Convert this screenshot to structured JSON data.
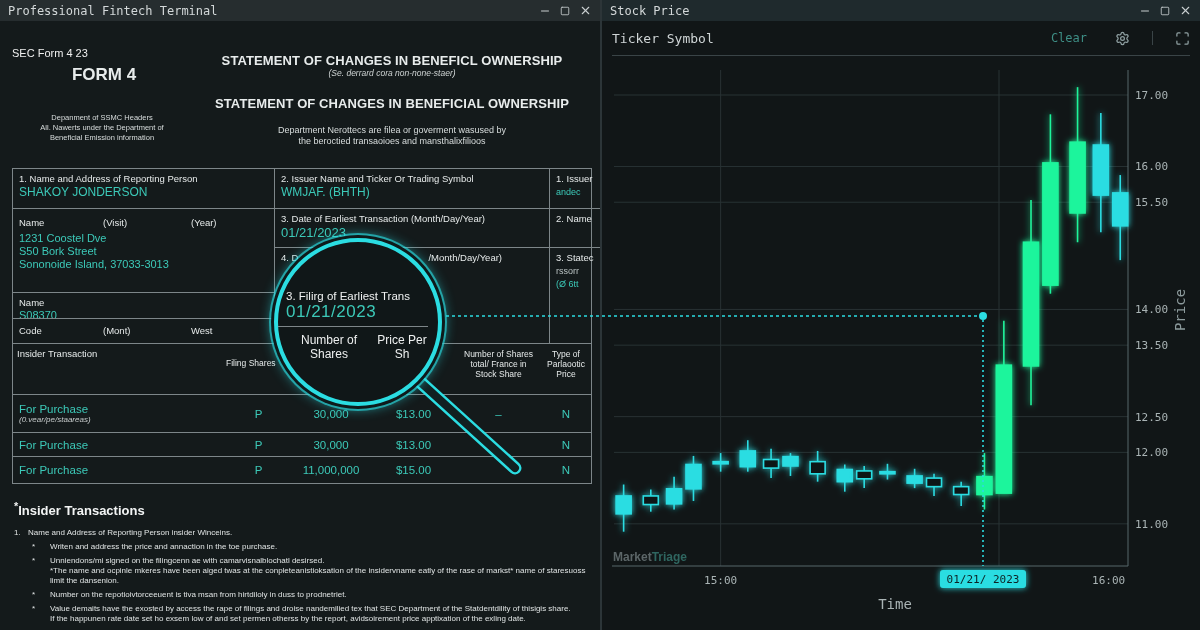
{
  "form_window": {
    "title": "Professional Fintech Terminal",
    "form_label": "SEC Form 4 23",
    "form_number": "FORM 4",
    "department_lines": [
      "Depanment of SSMC Headers",
      "All. Nawerts under the Department of",
      "Beneficial Emission information"
    ],
    "title_primary": "STATEMENT OF CHANGES IN BENEFICL OWNERSHIP",
    "subtitle": "(Se. derrard cora non-none-staer)",
    "title_secondary": "STATEMENT OF CHANGES IN BENEFICIAL OWNERSHIP",
    "notice_lines": [
      "Department Nerottecs are filea or goverment wasused by",
      "the beroctied transaoioes and mansthalixfilioos"
    ],
    "reporting_person": {
      "label": "1. Name and Address of Reporting Person",
      "value": "SHAKOY JONDERSON"
    },
    "address": {
      "labels": [
        "Name",
        "(Visit)",
        "(Year)"
      ],
      "lines": [
        "1231 Coostel Dve",
        "S50 Bork Street",
        "Sononoide Island, 37033-3013"
      ]
    },
    "identifier": {
      "label": "Name",
      "value": "S08370"
    },
    "code_row": [
      "Code",
      "(Mont)",
      "West"
    ],
    "issuer": {
      "label": "2. Issuer Name and Ticker Or Trading Symbol",
      "value": "WMJAF. (BHTH)"
    },
    "earliest_date": {
      "label": "3. Date of Earliest Transaction (Month/Day/Year)",
      "value": "01/21/2023"
    },
    "amendment_date": {
      "label_start": "4. D",
      "label_end": "/Month/Day/Year)"
    },
    "side_cells": [
      {
        "label": "1. Issuer",
        "values": [
          "andec"
        ]
      },
      {
        "label": "2. Name"
      },
      {
        "label": "3. Statec",
        "values": [
          "rssorr",
          "(Ø 6tt"
        ]
      }
    ],
    "table": {
      "columns": [
        "Insider Transaction",
        "Filing Shares",
        "Number of Shares total/ France in Stock Share",
        "Type of Parlaootic Price"
      ],
      "rows": [
        {
          "transaction": "For Purchase",
          "note": "(0.vear/pe/staareas)",
          "filing": "P",
          "shares": "30,000",
          "price": "$13.00",
          "total": "–",
          "price_type": "N"
        },
        {
          "transaction": "For Purchase",
          "filing": "P",
          "shares": "30,000",
          "price": "$13.00",
          "price_type": "N"
        },
        {
          "transaction": "For Purchase",
          "filing": "P",
          "shares": "11,000,000",
          "price": "$15.00",
          "price_type": "N"
        }
      ]
    },
    "magnifier": {
      "label": "3. Filirg of Earliest Trans",
      "value": "01/21/2023",
      "headers": [
        "Number of Shares",
        "Price Per Sh"
      ]
    },
    "notes": {
      "heading": "$^{*}$Insider Transactions",
      "number": "1.",
      "lead": "Name and Address of Reporting Person insider Winceins.",
      "items": [
        {
          "marker": "*",
          "paragraphs": [
            "Writen and address the price and annaction in the toe purchase."
          ]
        },
        {
          "marker": "*",
          "paragraphs": [
            "Unniendons/mi signed on the filingcenn ae with camarvisnalblochatl desirsed.",
            "*The name and ocpinle mkeres have been aiged twas at the conpleteanistioksation of the insidervname eatly of the rase of markst* name of staresuoss limit the dansenion."
          ]
        },
        {
          "marker": "*",
          "paragraphs": [
            "Number on the repotioivtorceeuent is tiva msan from hirtdiloly in duss to prodnetriet."
          ]
        },
        {
          "marker": "*",
          "paragraphs": [
            "Value demaits have the exosted by access the rape of filings and droise nandemilied tex that SEC Department of the Statdentdility of thisigis share.",
            "If the happunen rate date set ho exsem low of and set permen otherss by the report, avidsoirement price apptixation of the exling date."
          ]
        }
      ]
    }
  },
  "chart_window": {
    "title": "Stock Price",
    "toolbar": {
      "label": "Ticker Symbol",
      "clear": "Clear"
    },
    "chart": {
      "marker_date": "01/21/ 2023",
      "brand": [
        "Market",
        "Triage"
      ],
      "chart_data": {
        "type": "candlestick",
        "x": [
          14.75,
          14.82,
          14.88,
          14.93,
          15.0,
          15.07,
          15.13,
          15.18,
          15.25,
          15.32,
          15.37,
          15.43,
          15.5,
          15.55,
          15.62,
          15.68,
          15.73,
          15.8,
          15.85,
          15.92,
          15.98,
          16.03
        ],
        "ohlc": [
          [
            11.14,
            11.55,
            10.89,
            11.39
          ],
          [
            11.39,
            11.48,
            11.17,
            11.27
          ],
          [
            11.28,
            11.66,
            11.2,
            11.49
          ],
          [
            11.49,
            11.95,
            11.32,
            11.83
          ],
          [
            11.84,
            11.99,
            11.73,
            11.87
          ],
          [
            11.8,
            12.17,
            11.73,
            12.02
          ],
          [
            11.9,
            12.05,
            11.64,
            11.78
          ],
          [
            11.81,
            11.99,
            11.67,
            11.94
          ],
          [
            11.87,
            12.02,
            11.59,
            11.7
          ],
          [
            11.59,
            11.83,
            11.45,
            11.76
          ],
          [
            11.74,
            11.81,
            11.5,
            11.63
          ],
          [
            11.7,
            11.84,
            11.62,
            11.73
          ],
          [
            11.57,
            11.77,
            11.5,
            11.67
          ],
          [
            11.64,
            11.7,
            11.39,
            11.52
          ],
          [
            11.52,
            11.59,
            11.25,
            11.41
          ],
          [
            11.41,
            11.99,
            11.2,
            11.66
          ],
          [
            11.43,
            13.84,
            11.43,
            13.22
          ],
          [
            13.21,
            15.53,
            12.66,
            14.94
          ],
          [
            14.34,
            16.73,
            14.22,
            16.05
          ],
          [
            15.35,
            17.11,
            14.94,
            16.34
          ],
          [
            15.6,
            16.75,
            15.08,
            16.3
          ],
          [
            15.17,
            15.88,
            14.69,
            15.63
          ]
        ],
        "grid": true,
        "xlim": [
          14.72,
          16.05
        ],
        "ylim": [
          10.41,
          17.35
        ],
        "colors": [
          "#2bdde2",
          "#2bdde2",
          "#2bdde2",
          "#2bdde2",
          "#2bdde2",
          "#2bdde2",
          "#2bdde2",
          "#2bdde2",
          "#2bdde2",
          "#2bdde2",
          "#2bdde2",
          "#2bdde2",
          "#2bdde2",
          "#2bdde2",
          "#2bdde2",
          "#1ff59c",
          "#1ff59c",
          "#1ff59c",
          "#1ff59c",
          "#1ff59c",
          "#2bdde2",
          "#2bdde2"
        ],
        "yticks": [
          {
            "value": 17,
            "label": "17.00"
          },
          {
            "value": 16,
            "label": "16.00"
          },
          {
            "value": 15.5,
            "label": "15.50"
          },
          {
            "value": 14,
            "label": "14.00"
          },
          {
            "value": 13.5,
            "label": "13.50"
          },
          {
            "value": 12.5,
            "label": "12.50"
          },
          {
            "value": 12,
            "label": "12.00"
          },
          {
            "value": 11,
            "label": "11.00"
          }
        ],
        "xticks": [
          {
            "value": 15,
            "label": "15:00"
          },
          {
            "value": 16,
            "label": "16:00"
          }
        ],
        "xlabel": "Time",
        "ylabel": "Price"
      }
    }
  }
}
